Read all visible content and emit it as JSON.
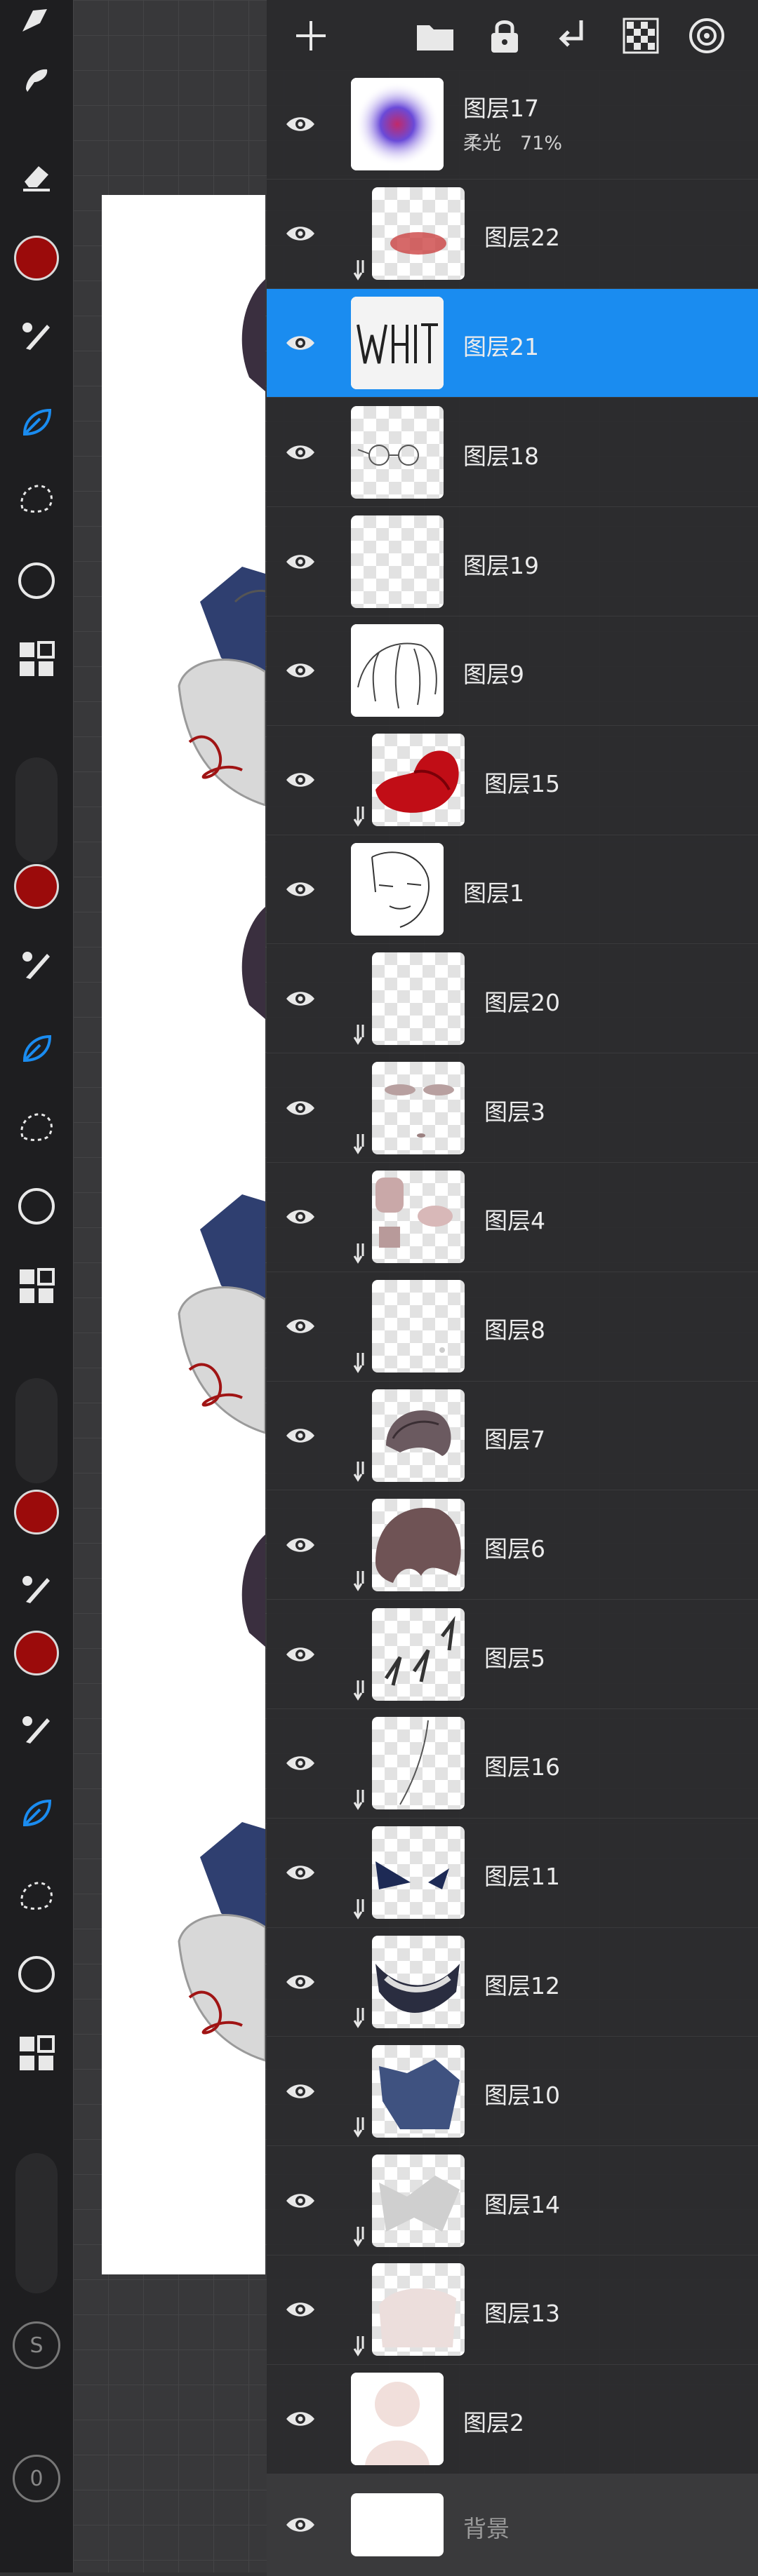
{
  "colors": {
    "accent": "#1a8cf0",
    "primary_color": "#9b0b0b",
    "panel_bg": "#2a2a2c",
    "toolbar_bg": "#1e1e20"
  },
  "toolbar": {
    "groups": [
      [
        "wrench-icon",
        "smudge-icon",
        "eraser-icon",
        "color-well",
        "brush-icon",
        "leaf-icon",
        "selection-icon",
        "circle-icon",
        "grid-icon"
      ],
      [
        "color-well",
        "brush-icon",
        "leaf-icon",
        "selection-icon",
        "circle-icon",
        "grid-icon"
      ],
      [
        "color-well",
        "brush-icon",
        "color-well",
        "brush-icon",
        "leaf-icon",
        "selection-icon",
        "circle-icon",
        "grid-icon"
      ]
    ],
    "badge_s": "S",
    "badge_zero": "0"
  },
  "top_actions": [
    "add-layer-icon",
    "folder-icon",
    "lock-icon",
    "merge-down-icon",
    "checker-icon",
    "target-icon"
  ],
  "layers": [
    {
      "name": "图层17",
      "sub": "柔光　71%",
      "clipped": false,
      "active": false,
      "thumb": "blur-glow"
    },
    {
      "name": "图层22",
      "clipped": true,
      "active": false,
      "thumb": "red-smudge"
    },
    {
      "name": "图层21",
      "clipped": false,
      "active": true,
      "thumb": "white-text"
    },
    {
      "name": "图层18",
      "clipped": false,
      "active": false,
      "thumb": "glasses"
    },
    {
      "name": "图层19",
      "clipped": false,
      "active": false,
      "thumb": "empty"
    },
    {
      "name": "图层9",
      "clipped": false,
      "active": false,
      "thumb": "hair-lines"
    },
    {
      "name": "图层15",
      "clipped": true,
      "active": false,
      "thumb": "red-hat"
    },
    {
      "name": "图层1",
      "clipped": false,
      "active": false,
      "thumb": "sketch"
    },
    {
      "name": "图层20",
      "clipped": true,
      "active": false,
      "thumb": "empty"
    },
    {
      "name": "图层3",
      "clipped": true,
      "active": false,
      "thumb": "face"
    },
    {
      "name": "图层4",
      "clipped": true,
      "active": false,
      "thumb": "blush"
    },
    {
      "name": "图层8",
      "clipped": true,
      "active": false,
      "thumb": "faint"
    },
    {
      "name": "图层7",
      "clipped": true,
      "active": false,
      "thumb": "hair-small"
    },
    {
      "name": "图层6",
      "clipped": true,
      "active": false,
      "thumb": "hair-big"
    },
    {
      "name": "图层5",
      "clipped": true,
      "active": false,
      "thumb": "dark-strokes"
    },
    {
      "name": "图层16",
      "clipped": true,
      "active": false,
      "thumb": "line"
    },
    {
      "name": "图层11",
      "clipped": true,
      "active": false,
      "thumb": "navy-tri"
    },
    {
      "name": "图层12",
      "clipped": true,
      "active": false,
      "thumb": "collar"
    },
    {
      "name": "图层10",
      "clipped": true,
      "active": false,
      "thumb": "navy-shape"
    },
    {
      "name": "图层14",
      "clipped": true,
      "active": false,
      "thumb": "gray-shape"
    },
    {
      "name": "图层13",
      "clipped": true,
      "active": false,
      "thumb": "pale-shape"
    },
    {
      "name": "图层2",
      "clipped": false,
      "active": false,
      "thumb": "silhouette"
    }
  ],
  "background_layer": {
    "name": "背景"
  }
}
